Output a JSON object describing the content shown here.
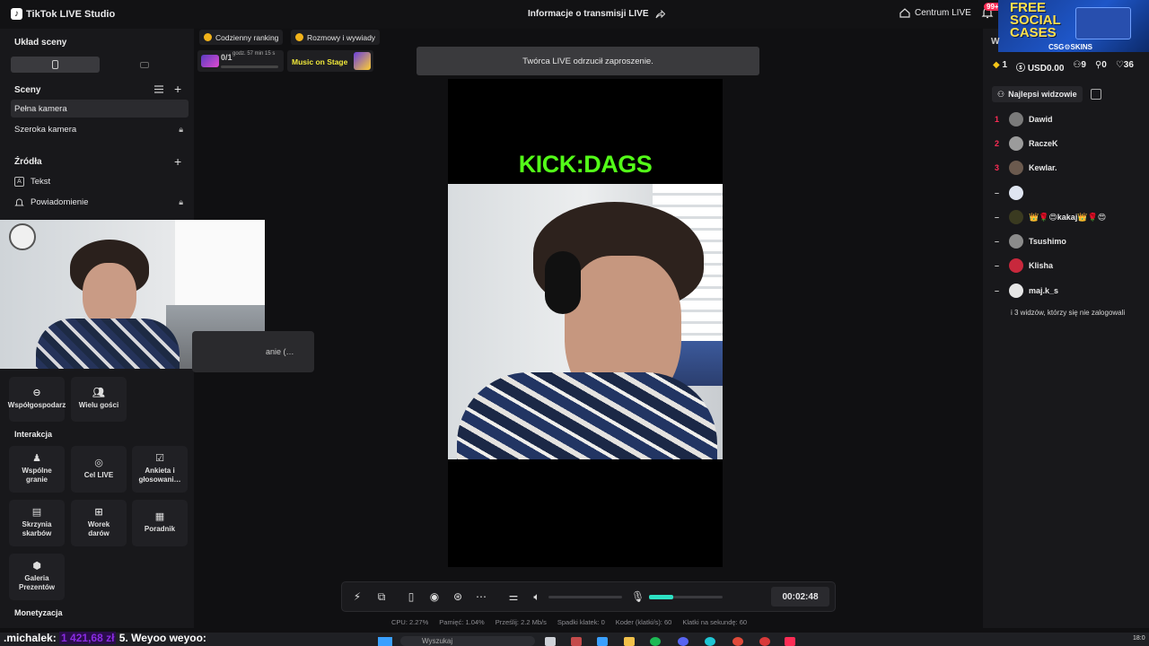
{
  "app": {
    "title": "TikTok LIVE Studio",
    "logo_glyph": "♪"
  },
  "header": {
    "center_title": "Informacje o transmisji LIVE",
    "share_icon": "share-icon",
    "centrum": "Centrum LIVE",
    "notifications_badge": "99+"
  },
  "left": {
    "layout_title": "Układ sceny",
    "scenes_title": "Sceny",
    "scenes": [
      {
        "label": "Pełna kamera",
        "selected": true
      },
      {
        "label": "Szeroka kamera",
        "locked": true
      }
    ],
    "sources_title": "Źródła",
    "sources": [
      {
        "label": "Tekst",
        "icon": "A"
      },
      {
        "label": "Powiadomienie",
        "locked": true
      }
    ],
    "partial_tooltip": "anie (…",
    "collab_tiles": [
      {
        "label": "Współgospodarz"
      },
      {
        "label": "Wielu gości"
      }
    ],
    "interaction_title": "Interakcja",
    "interaction_tiles": [
      {
        "label1": "Wspólne",
        "label2": "granie"
      },
      {
        "label1": "Cel LIVE",
        "label2": ""
      },
      {
        "label1": "Ankieta i",
        "label2": "głosowani…"
      },
      {
        "label1": "Skrzynia",
        "label2": "skarbów"
      },
      {
        "label1": "Worek",
        "label2": "darów"
      },
      {
        "label1": "Poradnik",
        "label2": ""
      },
      {
        "label1": "Galeria",
        "label2": "Prezentów"
      }
    ],
    "monetization_title": "Monetyzacja"
  },
  "widgets": {
    "daily_ranking": "Codzienny ranking",
    "talks": "Rozmowy i wywiady",
    "rank_progress": "0/1",
    "rank_time": "godz. 57 min 15 s",
    "music_on_stage": "Music on Stage"
  },
  "toast": "Twórca LIVE odrzucił zaproszenie.",
  "preview": {
    "overlay_text": "KICK:DAGS"
  },
  "controls": {
    "timer": "00:02:48",
    "mic_level": 0.33,
    "stats": [
      "CPU: 2.27%",
      "Pamięć: 1.04%",
      "Prześlij: 2.2 Mb/s",
      "Spadki klatek: 0",
      "Koder (klatki/s): 60",
      "Klatki na sekundę: 60"
    ]
  },
  "right": {
    "ad_title1": "FREE",
    "ad_title2": "SOCIAL",
    "ad_title3": "CASES",
    "ad_brand": "CSG⚙SKINS",
    "w_letter": "W",
    "stats": {
      "diamonds": "1",
      "usd": "USD0.00",
      "viewers": "9",
      "follows": "0",
      "likes": "36"
    },
    "top_viewers_tab": "Najlepsi widzowie",
    "viewers": [
      {
        "rank": "1",
        "name": "Dawid",
        "color": "#7a7a7a"
      },
      {
        "rank": "2",
        "name": "RaczeK",
        "color": "#9b9b9b"
      },
      {
        "rank": "3",
        "name": "Kewlar.",
        "color": "#6b5a4e"
      },
      {
        "rank": "–",
        "name": "",
        "color": "#dfe5f1"
      },
      {
        "rank": "–",
        "name": "👑🌹😍kakaj👑🌹😍",
        "color": "#3a3a20"
      },
      {
        "rank": "–",
        "name": "Tsushimo",
        "color": "#8b8b8b"
      },
      {
        "rank": "–",
        "name": "Klisha",
        "color": "#c8283c"
      },
      {
        "rank": "–",
        "name": "maj.k_s",
        "color": "#e6e6e6"
      }
    ],
    "footer_note": "i 3 widzów, którzy się nie zalogowali"
  },
  "taskbar": {
    "ticker_name": ".michalek:",
    "ticker_amount": "1 421,68 zł",
    "ticker_rest": "5. Weyoo weyoo:",
    "search_placeholder": "Wyszukaj",
    "clock": "18:0"
  }
}
